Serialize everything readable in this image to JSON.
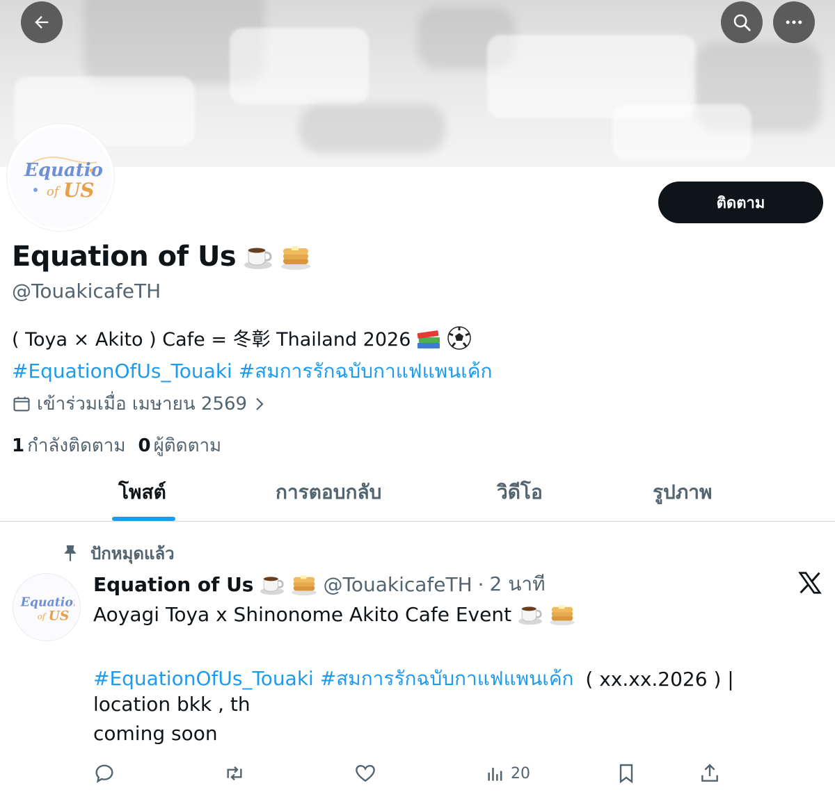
{
  "profile": {
    "display_name": "Equation of Us",
    "name_emojis": [
      "coffee-cup-emoji",
      "pancakes-emoji"
    ],
    "handle": "@TouakicafeTH",
    "follow_label": "ติดตาม",
    "avatar_text_line1": "Equation",
    "avatar_text_line2": "of US",
    "bio_text": "( Toya × Akito ) Cafe = 冬彰 Thailand 2026",
    "bio_emojis": [
      "books-emoji",
      "soccer-ball-emoji"
    ],
    "bio_hashtags": "#EquationOfUs_Touaki #สมการรักฉบับกาแฟแพนเค้ก",
    "joined": "เข้าร่วมเมื่อ เมษายน 2569",
    "following_count": "1",
    "following_label": "กำลังติดตาม",
    "followers_count": "0",
    "followers_label": "ผู้ติดตาม"
  },
  "header": {
    "icons": [
      "back-arrow-icon",
      "search-icon",
      "more-icon"
    ]
  },
  "tabs": [
    {
      "label": "โพสต์",
      "active": true
    },
    {
      "label": "การตอบกลับ",
      "active": false
    },
    {
      "label": "วิดีโอ",
      "active": false
    },
    {
      "label": "รูปภาพ",
      "active": false
    }
  ],
  "tweet": {
    "pinned_label": "ปักหมุดแล้ว",
    "author_name": "Equation of Us",
    "author_handle": "@TouakicafeTH",
    "separator": "·",
    "time": "2 นาที",
    "line1": "Aoyagi Toya x Shinonome Akito Cafe Event",
    "hashtags": "#EquationOfUs_Touaki #สมการรักฉบับกาแฟแพนเค้ก",
    "line2_rest": " ( xx.xx.2026 ) |",
    "line3": "location bkk , th",
    "line4": "coming soon",
    "views": "20"
  },
  "colors": {
    "accent": "#1d9bf0",
    "text": "#0f1419",
    "muted": "#536471",
    "button_dark": "#0f1419"
  }
}
